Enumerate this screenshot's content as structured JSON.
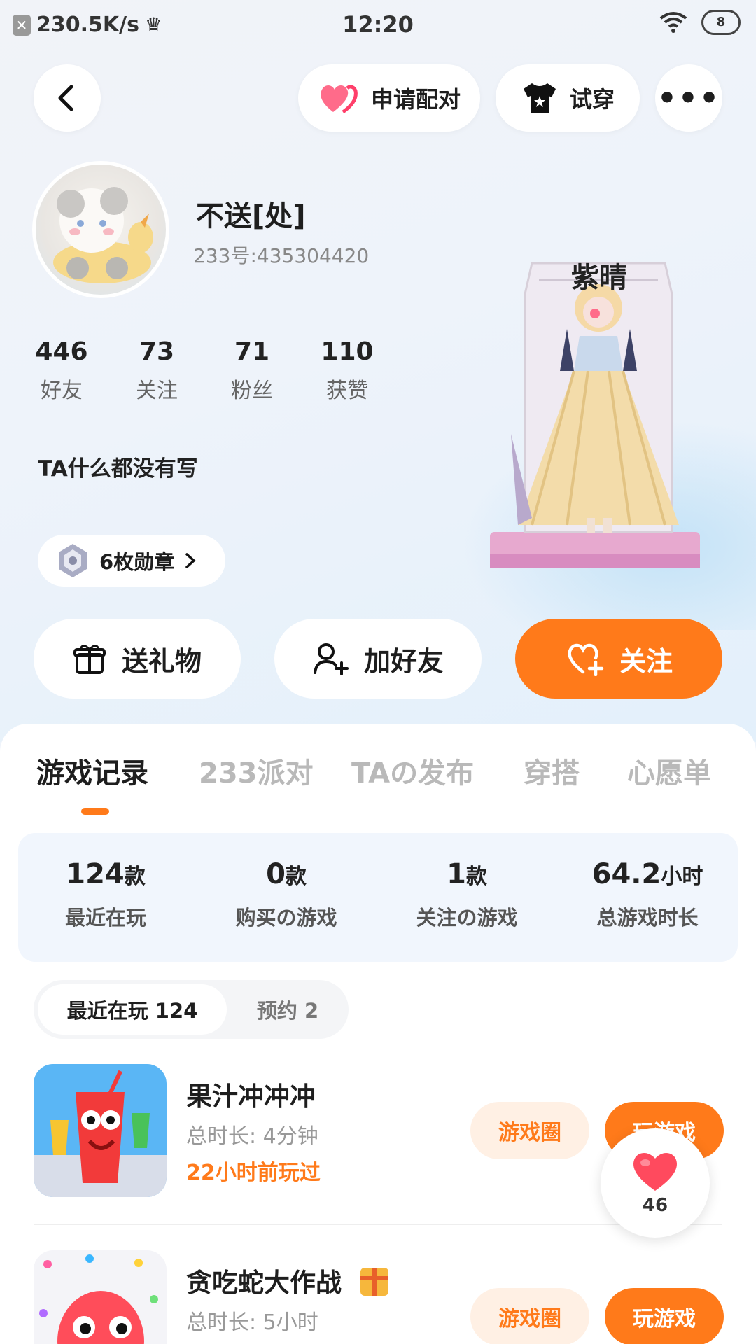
{
  "status_bar": {
    "speed": "230.5K/s",
    "time": "12:20",
    "battery": "8"
  },
  "header": {
    "pair_label": "申请配对",
    "try_label": "试穿",
    "more_label": "•••"
  },
  "profile": {
    "name": "不送[处]",
    "id": "233号:435304420",
    "stats": [
      {
        "value": "446",
        "label": "好友"
      },
      {
        "value": "73",
        "label": "关注"
      },
      {
        "value": "71",
        "label": "粉丝"
      },
      {
        "value": "110",
        "label": "获赞"
      }
    ],
    "bio": "TA什么都没有写",
    "medal_label": "6枚勋章",
    "figure_caption": "紫晴"
  },
  "actions": {
    "gift": "送礼物",
    "add_friend": "加好友",
    "follow": "关注"
  },
  "tabs": [
    "游戏记录",
    "233派对",
    "TAの发布",
    "穿搭",
    "心愿单"
  ],
  "summary": [
    {
      "value": "124",
      "unit": "款",
      "label": "最近在玩"
    },
    {
      "value": "0",
      "unit": "款",
      "label": "购买の游戏"
    },
    {
      "value": "1",
      "unit": "款",
      "label": "关注の游戏"
    },
    {
      "value": "64.2",
      "unit": "小时",
      "label": "总游戏时长"
    }
  ],
  "segments": {
    "recent": "最近在玩 124",
    "reserve": "预约 2"
  },
  "games": [
    {
      "name": "果汁冲冲冲",
      "duration": "总时长: 4分钟",
      "last_played": "22小时前玩过",
      "circle_label": "游戏圈",
      "play_label": "玩游戏"
    },
    {
      "name": "贪吃蛇大作战",
      "duration": "总时长: 5小时",
      "last_played": "",
      "circle_label": "游戏圈",
      "play_label": "玩游戏"
    }
  ],
  "like_float": {
    "count": "46"
  },
  "colors": {
    "accent": "#ff7a1a",
    "background": "#eef3fa"
  }
}
